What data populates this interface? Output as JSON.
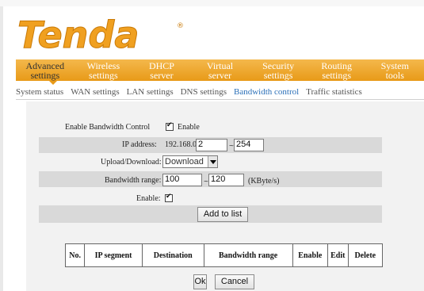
{
  "brand": {
    "logo_text": "Tenda",
    "logo_color": "#f0a020"
  },
  "main_nav": [
    {
      "label": "Advanced\nsettings",
      "active": true
    },
    {
      "label": "Wireless\nsettings"
    },
    {
      "label": "DHCP\nserver"
    },
    {
      "label": "Virtual\nserver"
    },
    {
      "label": "Security\nsettings"
    },
    {
      "label": "Routing\nsettings"
    },
    {
      "label": "System\ntools"
    }
  ],
  "sub_nav": [
    {
      "label": "System status"
    },
    {
      "label": "WAN settings"
    },
    {
      "label": "LAN settings"
    },
    {
      "label": "DNS settings"
    },
    {
      "label": "Bandwidth control",
      "active": true
    },
    {
      "label": "Traffic statistics"
    }
  ],
  "form": {
    "enable_bandwidth_label": "Enable Bandwidth Control",
    "enable_bandwidth_checked": true,
    "enable_bandwidth_text": "Enable",
    "ip_label": "IP address:",
    "ip_prefix": "192.168.0.",
    "ip_start": "2",
    "ip_range_sep": "~",
    "ip_end": "254",
    "direction_label": "Upload/Download:",
    "direction_value": "Download",
    "bandwidth_label": "Bandwidth range:",
    "bandwidth_min": "100",
    "bandwidth_sep": "~",
    "bandwidth_max": "120",
    "bandwidth_unit": "(KByte/s)",
    "enable_label": "Enable:",
    "enable_checked": true,
    "add_button": "Add to list"
  },
  "table": {
    "headers": [
      "No.",
      "IP segment",
      "Destination",
      "Bandwidth range",
      "Enable",
      "Edit",
      "Delete"
    ]
  },
  "actions": {
    "ok": "Ok",
    "cancel": "Cancel"
  },
  "colors": {
    "accent": "#e89a18",
    "active_link": "#2a6fb8",
    "band": "#d9d9d9",
    "panel": "#f2f2f2"
  }
}
